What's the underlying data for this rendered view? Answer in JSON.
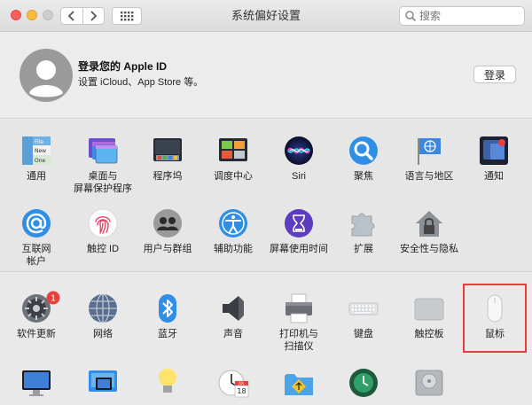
{
  "window": {
    "title": "系统偏好设置",
    "search_placeholder": "搜索"
  },
  "account": {
    "title": "登录您的 Apple ID",
    "subtitle": "设置 iCloud、App Store 等。",
    "login_label": "登录"
  },
  "section1": [
    {
      "label": "通用"
    },
    {
      "label": "桌面与\n屏幕保护程序"
    },
    {
      "label": "程序坞"
    },
    {
      "label": "调度中心"
    },
    {
      "label": "Siri"
    },
    {
      "label": "聚焦"
    },
    {
      "label": "语言与地区"
    },
    {
      "label": "通知"
    },
    {
      "label": "互联网\n帐户"
    },
    {
      "label": "触控 ID"
    },
    {
      "label": "用户与群组"
    },
    {
      "label": "辅助功能"
    },
    {
      "label": "屏幕使用时间"
    },
    {
      "label": "扩展"
    },
    {
      "label": "安全性与隐私"
    }
  ],
  "section2": [
    {
      "label": "软件更新",
      "badge": "1"
    },
    {
      "label": "网络"
    },
    {
      "label": "蓝牙"
    },
    {
      "label": "声音"
    },
    {
      "label": "打印机与\n扫描仪"
    },
    {
      "label": "键盘"
    },
    {
      "label": "触控板"
    },
    {
      "label": "鼠标"
    }
  ],
  "calendar_icon": {
    "month": "JUL",
    "day": "18"
  },
  "general_icon_words": [
    "File",
    "New",
    "One"
  ],
  "colors": {
    "highlight": "#e83c3c",
    "badge": "#e8413b",
    "accent": "#2f7de1"
  }
}
